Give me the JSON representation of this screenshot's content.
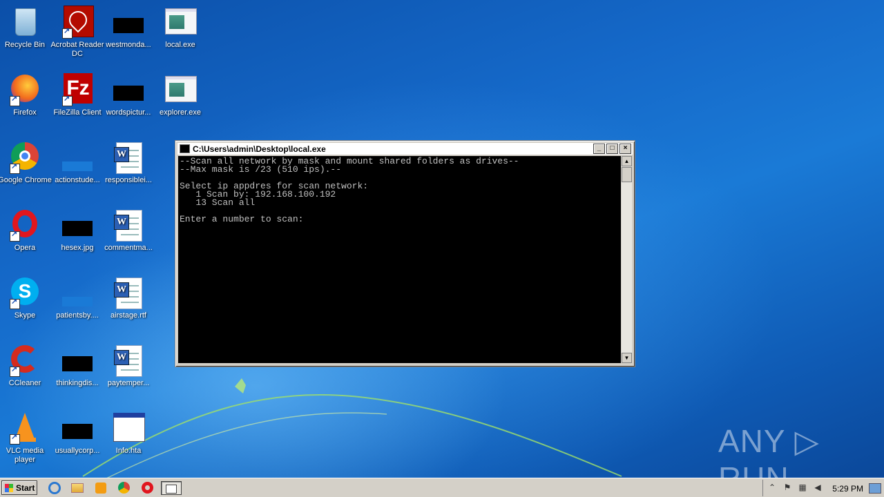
{
  "desktop_icons": [
    {
      "label": "Recycle Bin"
    },
    {
      "label": "Acrobat Reader DC"
    },
    {
      "label": "westmonda..."
    },
    {
      "label": "local.exe"
    },
    {
      "label": "Firefox"
    },
    {
      "label": "FileZilla Client"
    },
    {
      "label": "wordspictur..."
    },
    {
      "label": "explorer.exe"
    },
    {
      "label": "Google Chrome"
    },
    {
      "label": "actionstude..."
    },
    {
      "label": "responsiblei..."
    },
    {
      "label": "Opera"
    },
    {
      "label": "hesex.jpg"
    },
    {
      "label": "commentma..."
    },
    {
      "label": "Skype"
    },
    {
      "label": "patientsby...."
    },
    {
      "label": "airstage.rtf"
    },
    {
      "label": "CCleaner"
    },
    {
      "label": "thinkingdis..."
    },
    {
      "label": "paytemper..."
    },
    {
      "label": "VLC media player"
    },
    {
      "label": "usuallycorp..."
    },
    {
      "label": "Info.hta"
    }
  ],
  "console_window": {
    "title": "C:\\Users\\admin\\Desktop\\local.exe",
    "minimize_glyph": "_",
    "maximize_glyph": "□",
    "close_glyph": "×",
    "output": "--Scan all network by mask and mount shared folders as drives--\n--Max mask is /23 (510 ips).--\n\nSelect ip appdres for scan network:\n   1 Scan by: 192.168.100.192\n   13 Scan all\n\nEnter a number to scan:"
  },
  "taskbar": {
    "start_label": "Start",
    "clock": "5:29 PM",
    "tray_chevron": "⌃"
  },
  "watermark": "ANY ▷ RUN",
  "colors": {
    "console_bg": "#000000",
    "console_fg": "#c0c0c0",
    "taskbar_bg": "#d4d0c8"
  }
}
